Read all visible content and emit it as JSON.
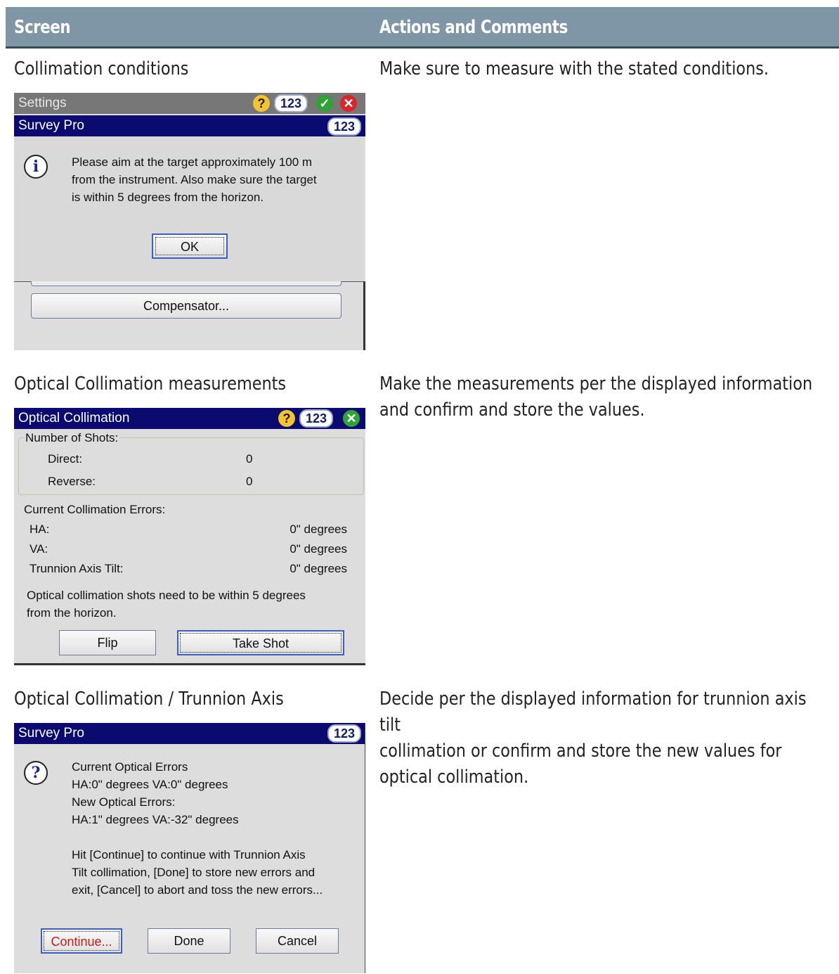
{
  "header": {
    "screen": "Screen",
    "actions": "Actions and Comments"
  },
  "rows": [
    {
      "caption": "Collimation conditions",
      "comment": "Make sure to measure with the stated conditions.",
      "screen": {
        "settings_title": "Settings",
        "dialog_title": "Survey Pro",
        "num_badge": "123",
        "help_icon": "?",
        "message": "Please aim at the target approximately 100 m\nfrom the instrument.  Also make sure the target\nis within 5 degrees from the horizon.",
        "ok": "OK",
        "compensator": "Compensator..."
      }
    },
    {
      "caption": "Optical Collimation measurements",
      "comment": "Make the measurements per the displayed information\nand confirm and store the values.",
      "screen": {
        "title": "Optical Collimation",
        "num_badge": "123",
        "help_icon": "?",
        "shots_label": "Number of Shots:",
        "direct_label": "Direct:",
        "direct_value": "0",
        "reverse_label": "Reverse:",
        "reverse_value": "0",
        "errors_label": "Current Collimation Errors:",
        "ha_label": "HA:",
        "ha_value": "0\" degrees",
        "va_label": "VA:",
        "va_value": "0\" degrees",
        "tilt_label": "Trunnion Axis Tilt:",
        "tilt_value": "0\" degrees",
        "note": "Optical collimation shots need to be within 5 degrees\nfrom the horizon.",
        "flip": "Flip",
        "take_shot": "Take Shot"
      }
    },
    {
      "caption": "Optical Collimation / Trunnion Axis",
      "comment": "Decide per the displayed information for trunnion axis tilt\ncollimation or confirm and store the new values for\noptical collimation.",
      "screen": {
        "title": "Survey Pro",
        "num_badge": "123",
        "message": "Current Optical Errors\nHA:0\" degrees  VA:0\" degrees\nNew Optical Errors:\nHA:1\" degrees  VA:-32\" degrees\n\nHit [Continue] to continue with Trunnion Axis\nTilt collimation,  [Done] to store new errors and\nexit, [Cancel] to abort and toss the new errors...",
        "continue": "Continue...",
        "done": "Done",
        "cancel": "Cancel"
      }
    }
  ]
}
